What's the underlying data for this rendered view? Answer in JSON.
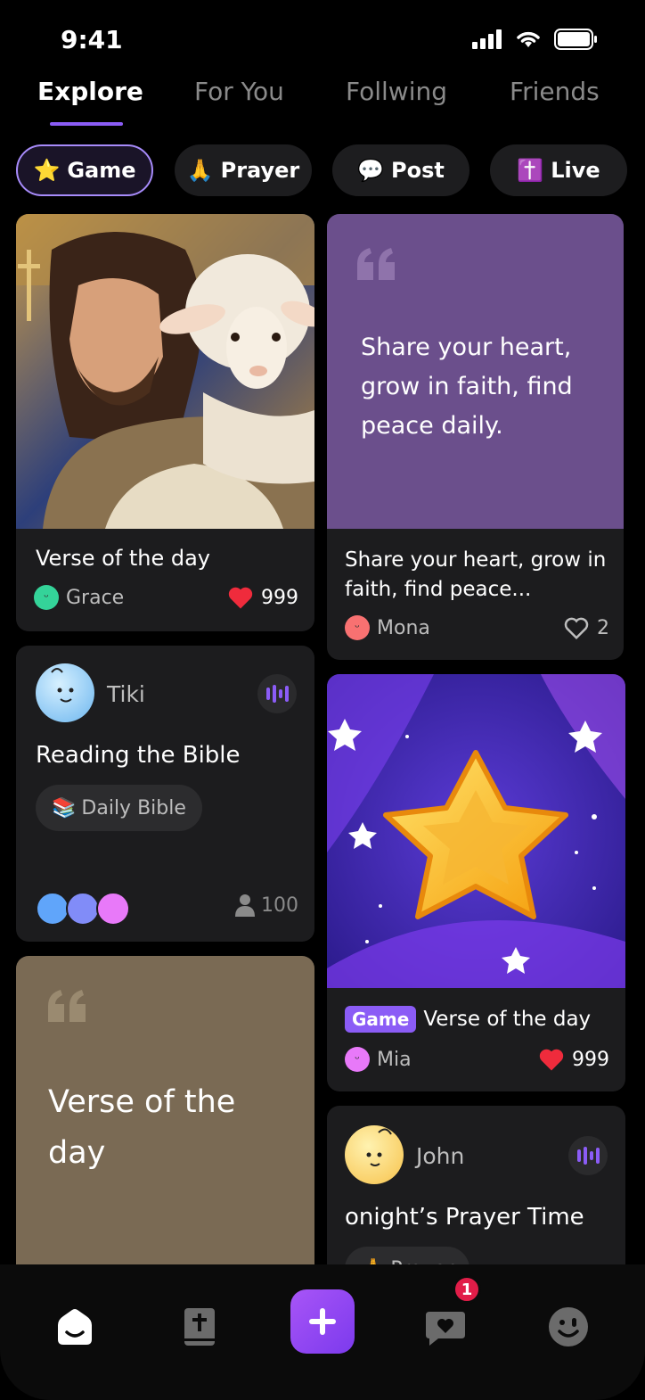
{
  "status": {
    "time": "9:41"
  },
  "tabs": [
    {
      "label": "Explore",
      "active": true
    },
    {
      "label": "For You"
    },
    {
      "label": "Follwing"
    },
    {
      "label": "Friends"
    }
  ],
  "chips": [
    {
      "emoji": "⭐",
      "label": "Game",
      "active": true
    },
    {
      "emoji": "🙏",
      "label": "Prayer"
    },
    {
      "emoji": "💬",
      "label": "Post"
    },
    {
      "emoji": "✝️",
      "label": "Live"
    }
  ],
  "cards": {
    "verse_image": {
      "title": "Verse of the day",
      "author": "Grace",
      "likes": "999"
    },
    "quote_purple": {
      "quote": "Share your heart, grow in faith, find peace daily.",
      "title": "Share your heart, grow in faith, find peace...",
      "author": "Mona",
      "likes": "2"
    },
    "tiki_room": {
      "user": "Tiki",
      "title": "Reading the Bible",
      "tag_emoji": "📚",
      "tag": "Daily Bible",
      "count": "100"
    },
    "game_star": {
      "badge": "Game",
      "title": "Verse of the day",
      "author": "Mia",
      "likes": "999"
    },
    "quote_brown": {
      "quote": "Verse of the day"
    },
    "john_room": {
      "user": "John",
      "title": "onight’s Prayer Time",
      "tag": "Prayer"
    }
  },
  "nav": {
    "messages_badge": "1"
  },
  "colors": {
    "accent": "#8b5cf6",
    "purple_card": "#6b4f8c",
    "brown_card": "#7a6a54",
    "like_red": "#ef2b3c"
  }
}
